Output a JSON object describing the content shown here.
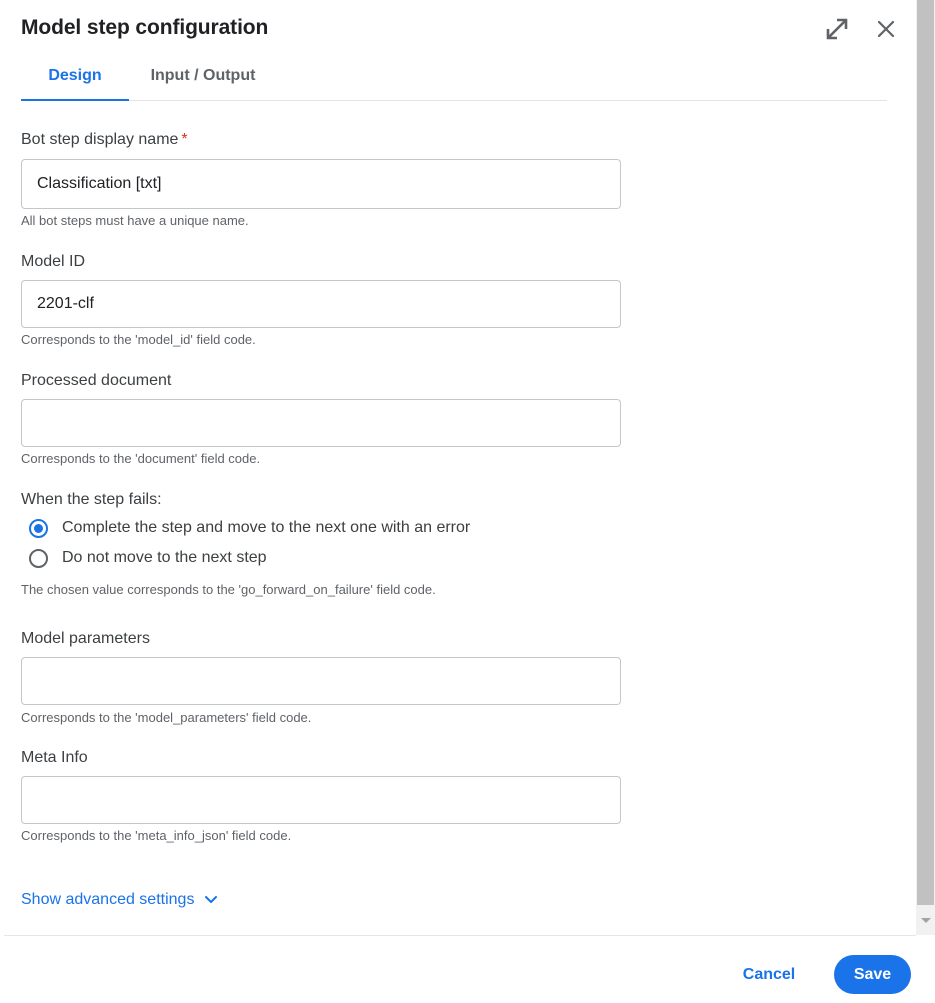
{
  "dialog": {
    "title": "Model step configuration",
    "icons": {
      "expand": "expand-diagonal-icon",
      "close": "close-icon"
    }
  },
  "tabs": [
    {
      "label": "Design",
      "active": true
    },
    {
      "label": "Input / Output",
      "active": false
    }
  ],
  "form": {
    "display_name": {
      "label": "Bot step display name",
      "required_mark": "*",
      "value": "Classification [txt]",
      "hint": "All bot steps must have a unique name."
    },
    "model_id": {
      "label": "Model ID",
      "value": "2201-clf",
      "hint": "Corresponds to the 'model_id' field code."
    },
    "processed_document": {
      "label": "Processed document",
      "value": "",
      "hint": "Corresponds to the 'document' field code."
    },
    "failure": {
      "label": "When the step fails:",
      "options": [
        {
          "label": "Complete the step and move to the next one with an error",
          "checked": true
        },
        {
          "label": "Do not move to the next step",
          "checked": false
        }
      ],
      "hint": "The chosen value corresponds to the 'go_forward_on_failure' field code."
    },
    "model_parameters": {
      "label": "Model parameters",
      "value": "",
      "hint": "Corresponds to the 'model_parameters' field code."
    },
    "meta_info": {
      "label": "Meta Info",
      "value": "",
      "hint": "Corresponds to the 'meta_info_json' field code."
    }
  },
  "advanced": {
    "label": "Show advanced settings",
    "icon": "chevron-down-icon"
  },
  "footer": {
    "cancel_label": "Cancel",
    "save_label": "Save"
  },
  "colors": {
    "accent": "#1a73e8",
    "required": "#d93025",
    "text": "#202124",
    "muted": "#5f6368"
  }
}
